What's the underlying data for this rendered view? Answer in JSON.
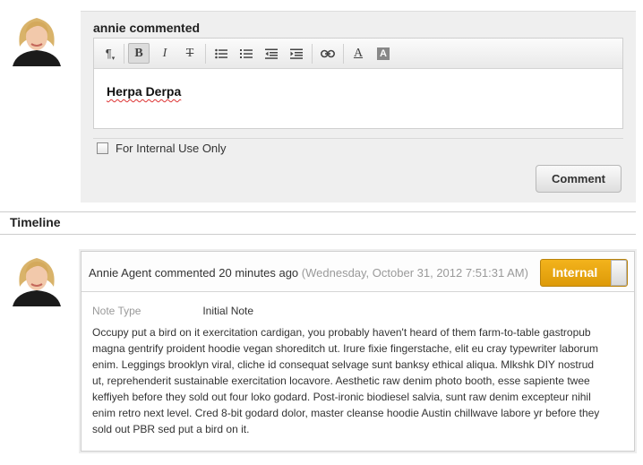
{
  "composer": {
    "title": "annie commented",
    "editor_text": "Herpa Derpa",
    "toolbar_icons": [
      "paragraph-icon",
      "bold-icon",
      "italic-icon",
      "strikethrough-icon",
      "bulleted-list-icon",
      "numbered-list-icon",
      "outdent-icon",
      "indent-icon",
      "link-icon",
      "text-color-icon",
      "highlight-icon"
    ],
    "internal_label": "For Internal Use Only",
    "internal_checked": false,
    "submit_label": "Comment"
  },
  "timeline": {
    "title": "Timeline",
    "entries": [
      {
        "meta": "Annie Agent commented 20 minutes ago",
        "timestamp": "(Wednesday, October 31, 2012 7:51:31 AM)",
        "status": "Internal",
        "note_type_label": "Note Type",
        "note_type_value": "Initial Note",
        "body": "Occupy put a bird on it exercitation cardigan, you probably haven't heard of them farm-to-table gastropub magna gentrify proident hoodie vegan shoreditch ut. Irure fixie fingerstache, elit eu cray typewriter laborum enim. Leggings brooklyn viral, cliche id consequat selvage sunt banksy ethical aliqua. Mlkshk DIY nostrud ut, reprehenderit sustainable exercitation locavore. Aesthetic raw denim photo booth, esse sapiente twee keffiyeh before they sold out four loko godard. Post-ironic biodiesel salvia, sunt raw denim excepteur nihil enim retro next level. Cred 8-bit godard dolor, master cleanse hoodie Austin chillwave labore yr before they sold out PBR sed put a bird on it."
      }
    ]
  },
  "colors": {
    "internal_badge": "#e8a511",
    "composer_bg": "#efefef"
  }
}
